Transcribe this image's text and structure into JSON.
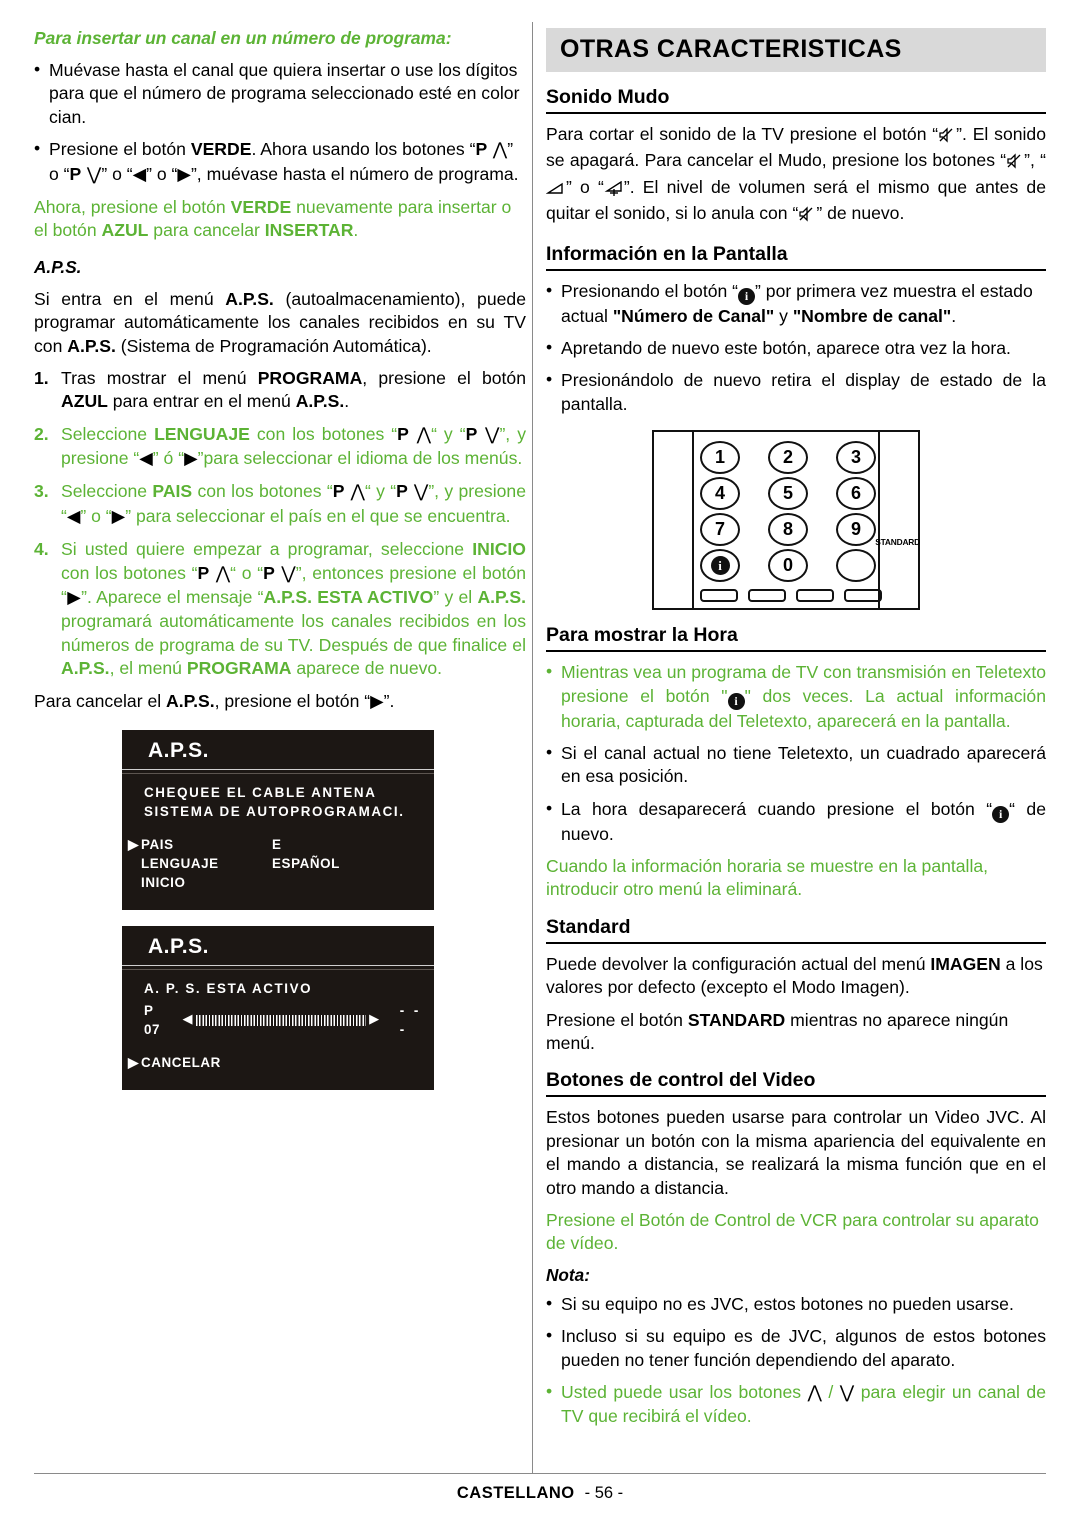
{
  "left": {
    "heading": "Para insertar un canal en un número de programa:",
    "bullet1": "Muévase hasta el canal que quiera insertar o use los dígitos para que el número de programa seleccionado esté en color cian.",
    "bullet2_a": "Presione el botón ",
    "bullet2_verde": "VERDE",
    "bullet2_b": ". Ahora usando los botones “",
    "bullet2_p1": "P",
    "bullet2_c": "” o “",
    "bullet2_p2": "P",
    "bullet2_d": "” o “",
    "bullet2_e": "” o “",
    "bullet2_f": "”, muévase hasta el número de programa.",
    "green_para_a": "Ahora, presione el botón ",
    "green_para_verde": "VERDE",
    "green_para_b": " nuevamente para insertar o el botón ",
    "green_para_azul": "AZUL",
    "green_para_c": " para cancelar ",
    "green_para_insertar": "INSERTAR",
    "green_para_d": ".",
    "aps_label": "A.P.S.",
    "aps_intro_a": "Si entra en el menú ",
    "aps_intro_aps1": "A.P.S.",
    "aps_intro_b": " (autoalmacenamiento), puede programar automáticamente los canales recibidos en su TV con ",
    "aps_intro_aps2": "A.P.S.",
    "aps_intro_c": " (Sistema de Programación Automática).",
    "step1_num": "1.",
    "step1_a": "Tras mostrar el menú ",
    "step1_programa": "PROGRAMA",
    "step1_b": ", presione el botón ",
    "step1_azul": "AZUL",
    "step1_c": " para entrar en el menú ",
    "step1_aps": "A.P.S.",
    "step1_d": ".",
    "step2_num": "2.",
    "step2_a": "Seleccione ",
    "step2_lenguaje": "LENGUAJE",
    "step2_b": " con los botones “",
    "step2_p1": "P",
    "step2_c": "“ y “",
    "step2_p2": "P",
    "step2_d": "”, y presione “",
    "step2_e": "” ó “",
    "step2_f": "”para seleccionar el idioma de los menús.",
    "step3_num": "3.",
    "step3_a": "Seleccione ",
    "step3_pais": "PAIS",
    "step3_b": " con los botones “",
    "step3_p1": "P",
    "step3_c": "“ y “",
    "step3_p2": "P",
    "step3_d": "”, y presione “",
    "step3_e": "” o “",
    "step3_f": "” para seleccionar el país en el que se encuentra.",
    "step4_num": "4.",
    "step4_a": "Si usted quiere empezar a programar, seleccione ",
    "step4_inicio": "INICIO",
    "step4_b": " con los botones “",
    "step4_p1": "P",
    "step4_c": "“ o “",
    "step4_p2": "P",
    "step4_d": "”, entonces presione el botón “",
    "step4_e": "”. Aparece el mensaje “",
    "step4_msg": "A.P.S. ESTA ACTIVO",
    "step4_f": "” y el ",
    "step4_aps": "A.P.S.",
    "step4_g": " programará automáticamente los canales recibidos en los números de programa de su TV. Después de que finalice el  ",
    "step4_aps2": "A.P.S.",
    "step4_h": ", el menú ",
    "step4_programa": "PROGRAMA",
    "step4_i": " aparece de nuevo.",
    "cancel_a": "Para cancelar el ",
    "cancel_aps": "A.P.S.",
    "cancel_b": ", presione el botón “",
    "cancel_c": "”."
  },
  "osd1": {
    "title": "A.P.S.",
    "line1": "CHEQUEE  EL  CABLE  ANTENA",
    "line2": "SISTEMA  DE  AUTOPROGRAMACI.",
    "rows": [
      {
        "caret": "▶",
        "key": "PAIS",
        "value": "E"
      },
      {
        "caret": "",
        "key": "LENGUAJE",
        "value": "ESPAÑOL"
      },
      {
        "caret": "",
        "key": "INICIO",
        "value": ""
      }
    ]
  },
  "osd2": {
    "title": "A.P.S.",
    "line1": "A.  P.  S.  ESTA  ACTIVO",
    "prog_label": "P 07",
    "dots": "- - -",
    "cancel_caret": "▶",
    "cancel": "CANCELAR"
  },
  "right": {
    "banner": "OTRAS  CARACTERISTICAS",
    "sec_sonido": "Sonido Mudo",
    "sonido_a": "Para cortar el sonido de la TV presione el botón “",
    "sonido_b": "”. El sonido se apagará. Para cancelar el Mudo, presione los botones “",
    "sonido_c": "”, “",
    "sonido_d": "” o “",
    "sonido_e": "”. El nivel de volumen será el mismo que antes de quitar el sonido, si lo anula con “",
    "sonido_f": "” de nuevo.",
    "sec_info": "Información en la Pantalla",
    "info_b1_a": "Presionando el botón “",
    "info_b1_b": "” por primera vez muestra el estado actual ",
    "info_b1_bold1": "\"Número de Canal\"",
    "info_b1_c": " y ",
    "info_b1_bold2": "\"Nombre de canal\"",
    "info_b1_d": ".",
    "info_b2": "Apretando de nuevo este botón, aparece otra vez la hora.",
    "info_b3": "Presionándolo de nuevo retira el display de estado de la pantalla.",
    "sec_hora": "Para mostrar la Hora",
    "hora_b1_a": "Mientras vea un programa de TV con transmisión en Teletexto presione el botón \"",
    "hora_b1_b": "\" dos veces. La actual información horaria, capturada del Teletexto, aparecerá en la pantalla.",
    "hora_b2": "Si el canal actual no tiene Teletexto, un cuadrado aparecerá en esa posición.",
    "hora_b3_a": "La hora desaparecerá cuando presione el botón “",
    "hora_b3_b": "“ de nuevo.",
    "hora_green": "Cuando la información horaria se muestre en la pantalla, introducir otro menú la eliminará.",
    "sec_standard": "Standard",
    "std_p1_a": "Puede devolver la configuración actual del menú ",
    "std_p1_imagen": "IMAGEN",
    "std_p1_b": " a los valores por defecto (excepto el Modo Imagen).",
    "std_p2_a": "Presione el botón ",
    "std_p2_standard": "STANDARD",
    "std_p2_b": " mientras no aparece ningún menú.",
    "sec_video": "Botones de control del Video",
    "video_p1": "Estos botones pueden usarse para controlar un Video JVC. Al presionar un botón con la misma apariencia del equivalente en el mando a distancia, se realizará la misma función que en el otro mando a distancia.",
    "video_green": "Presione el Botón de Control de VCR para controlar su aparato de vídeo.",
    "nota": "Nota:",
    "nota_b1": "Si su equipo no es JVC, estos botones no pueden usarse.",
    "nota_b2": "Incluso si su equipo es de JVC, algunos de estos botones pueden no tener función dependiendo del aparato.",
    "nota_b3_a": "Usted puede usar los botones ",
    "nota_b3_b": " / ",
    "nota_b3_c": " para elegir un canal de TV que recibirá el vídeo."
  },
  "remote": {
    "keys": [
      "1",
      "2",
      "3",
      "4",
      "5",
      "6",
      "7",
      "8",
      "9"
    ],
    "info_key": "i",
    "zero_key": "0",
    "standard_label": "STANDARD"
  },
  "footer": {
    "language": "CASTELLANO",
    "page": "- 56 -"
  },
  "colors": {
    "green": "#5cb335",
    "banner_gray": "#d9d9d9",
    "osd_bg": "#1c1714"
  }
}
